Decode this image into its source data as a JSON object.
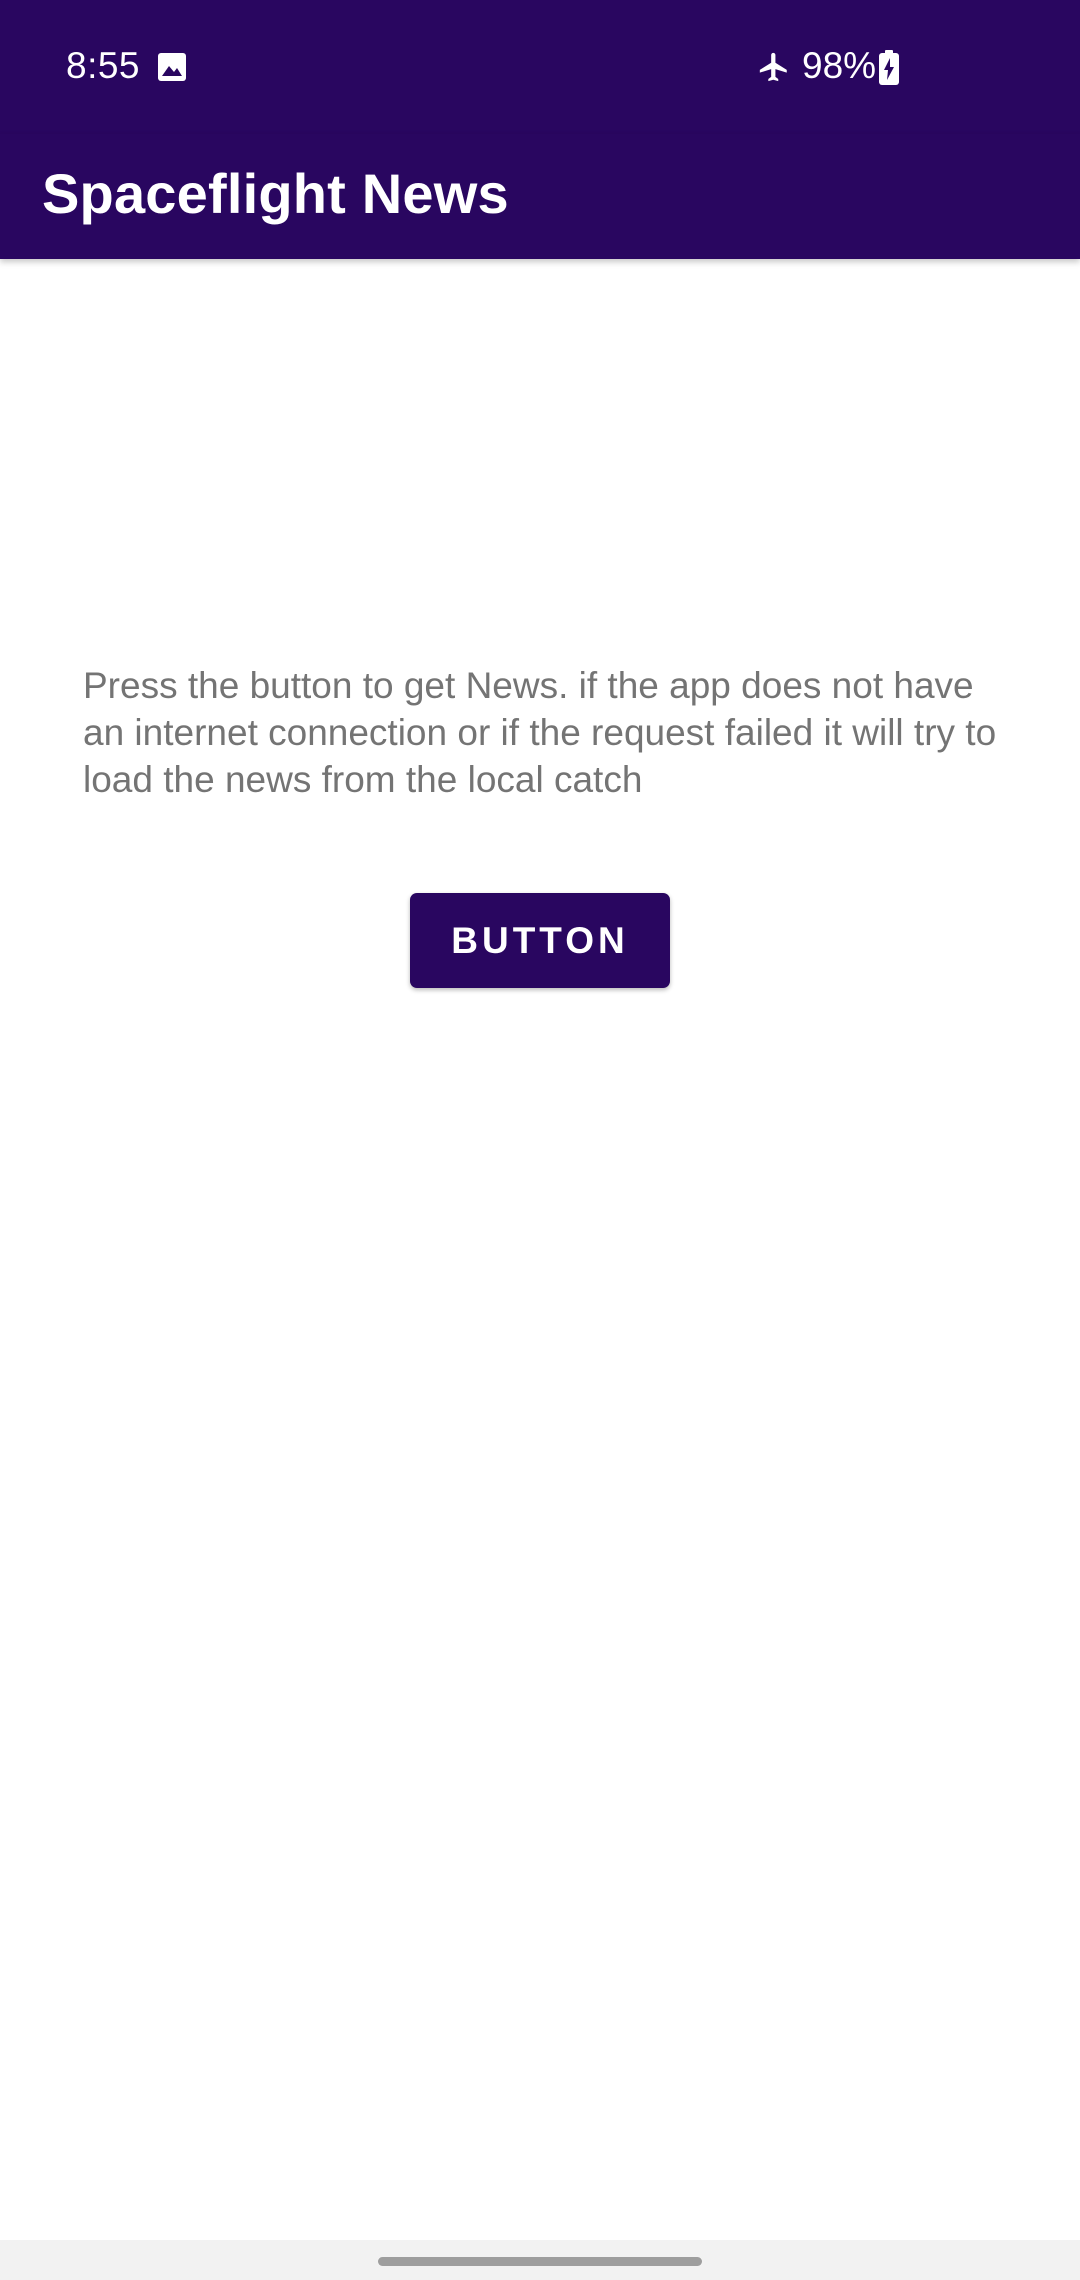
{
  "status_bar": {
    "time": "8:55",
    "battery": "98%",
    "icons": [
      "gallery-icon",
      "airplane-mode-icon",
      "battery-charging-icon"
    ]
  },
  "app_bar": {
    "title": "Spaceflight News"
  },
  "main": {
    "description": "Press the button to get News. if the app does not have an internet connection or if the request failed it will try to load the news from the local catch",
    "button_label": "BUTTON"
  },
  "colors": {
    "primary": "#290660",
    "on_primary": "#ffffff",
    "body_text": "#747474",
    "background": "#ffffff"
  }
}
